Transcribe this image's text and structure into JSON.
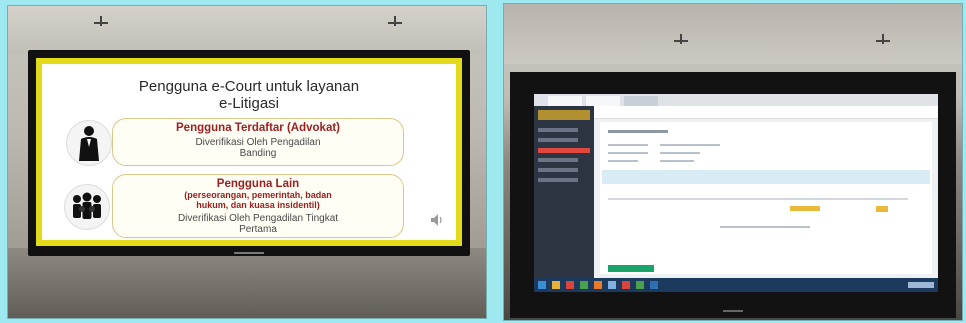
{
  "left_photo": {
    "slide": {
      "title_line1": "Pengguna e-Court untuk layanan",
      "title_line2": "e-Litigasi",
      "registered": {
        "heading": "Pengguna Terdaftar (Advokat)",
        "detail_line1": "Diverifikasi Oleh Pengadilan",
        "detail_line2": "Banding"
      },
      "others": {
        "heading": "Pengguna Lain",
        "sub_line1": "(perseorangan, pemerintah, badan",
        "sub_line2": "hukum, dan kuasa insidentil)",
        "detail_line1": "Diverifikasi Oleh Pengadilan Tingkat",
        "detail_line2": "Pertama"
      }
    },
    "colors": {
      "bezel": "#e3da1c",
      "heading": "#9b2020",
      "box_border": "#d9c78a"
    },
    "icons": [
      "advocate-icon",
      "people-group-icon",
      "speaker-icon"
    ]
  },
  "right_photo": {
    "screen": "e-Court web application (text unreadable in photo)",
    "colors": {
      "sidebar": "#2d3542",
      "active_menu": "#e0473f",
      "button": "#1aa36a",
      "accent": "#e9b93a",
      "taskbar": "#1c3a5e"
    }
  }
}
